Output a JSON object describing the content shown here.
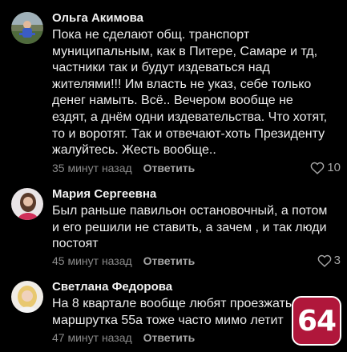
{
  "comments": [
    {
      "author": "Ольга Акимова",
      "text": "Пока не сделают общ. транспорт\nмуниципальным, как в Питере, Самаре и тд,\nчастники так и будут издеваться над\nжителями!!! Им власть не указ, себе только\nденег намыть. Всё.. Вечером вообще не\nездят, а днём одни издевательства. Что хотят,\nто и воротят. Так и отвечают-хоть Президенту\nжалуйтесь. Жесть вообще..",
      "time": "35 минут назад",
      "reply": "Ответить",
      "likes": "10"
    },
    {
      "author": "Мария Сергеевна",
      "text": "Был раньше павильон остановочный, а потом\nи его решили не ставить, а зачем , и так люди\nпостоят",
      "time": "45 минут назад",
      "reply": "Ответить",
      "likes": "3"
    },
    {
      "author": "Светлана Федорова",
      "text": "На 8 квартале вообще любят проезжать\nмаршрутка 55а тоже часто мимо летит",
      "time": "47 минут назад",
      "reply": "Ответить",
      "likes": ""
    }
  ],
  "badge": {
    "label": "64"
  },
  "colors": {
    "background": "#000000",
    "badge": "#b0173b"
  }
}
